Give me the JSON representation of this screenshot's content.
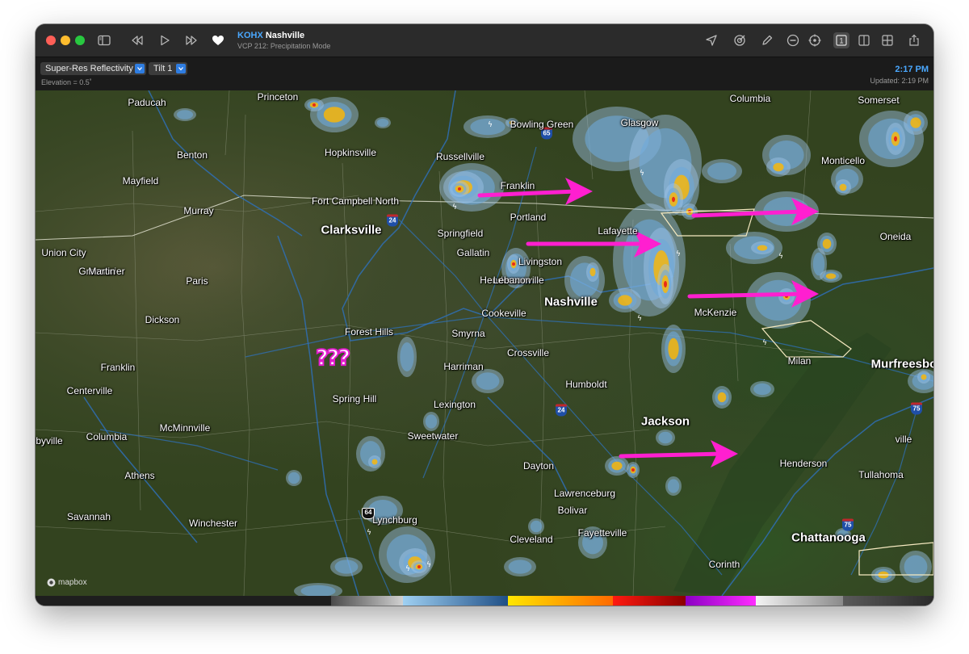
{
  "titlebar": {
    "station_call": "KOHX",
    "station_name": "Nashville",
    "subtitle": "VCP 212: Precipitation Mode",
    "traffic_lights": {
      "close": "#ff5f57",
      "minimize": "#febc2e",
      "zoom": "#28c840"
    },
    "toolbar_left_icons": [
      "sidebar-toggle-icon",
      "rewind-icon",
      "play-icon",
      "fast-forward-icon",
      "heart-icon"
    ],
    "toolbar_right_icons": [
      "location-arrow-icon",
      "target-icon",
      "pencil-icon",
      "minus-circle-icon",
      "crosshair-icon",
      "single-pane-icon",
      "split-pane-icon",
      "quad-pane-icon",
      "share-icon"
    ],
    "single_pane_label": "1"
  },
  "controls": {
    "product": "Super-Res Reflectivity",
    "tilt": "Tilt 1",
    "elevation": "Elevation = 0.5˚",
    "time": "2:17 PM",
    "updated": "Updated: 2:19 PM",
    "accent": "#4aa8ff"
  },
  "map": {
    "attribution": "mapbox",
    "annotation": "???",
    "annotation_color": "#e41ccf",
    "arrow_color": "#ff1fd0",
    "highway_shields": [
      "24",
      "65",
      "24",
      "75",
      "75",
      "64"
    ],
    "cities": [
      {
        "name": "Paducah",
        "big": false
      },
      {
        "name": "Princeton",
        "big": false
      },
      {
        "name": "Bowling Green",
        "big": false
      },
      {
        "name": "Glasgow",
        "big": false
      },
      {
        "name": "Columbia",
        "big": false
      },
      {
        "name": "Somerset",
        "big": false
      },
      {
        "name": "Hopkinsville",
        "big": false
      },
      {
        "name": "Russellville",
        "big": false
      },
      {
        "name": "Benton",
        "big": false
      },
      {
        "name": "Mayfield",
        "big": false
      },
      {
        "name": "Franklin",
        "big": false
      },
      {
        "name": "Monticello",
        "big": false
      },
      {
        "name": "Fort Campbell North",
        "big": false
      },
      {
        "name": "Murray",
        "big": false
      },
      {
        "name": "Portland",
        "big": false
      },
      {
        "name": "Clarksville",
        "big": true
      },
      {
        "name": "Springfield",
        "big": false
      },
      {
        "name": "Lafayette",
        "big": false
      },
      {
        "name": "Oneida",
        "big": false
      },
      {
        "name": "Union City",
        "big": false
      },
      {
        "name": "Greenbrier",
        "big": false
      },
      {
        "name": "Gallatin",
        "big": false
      },
      {
        "name": "Livingston",
        "big": false
      },
      {
        "name": "Martin",
        "big": false
      },
      {
        "name": "Paris",
        "big": false
      },
      {
        "name": "Hendersonville",
        "big": false
      },
      {
        "name": "Lebanon",
        "big": false
      },
      {
        "name": "Nashville",
        "big": true
      },
      {
        "name": "Cookeville",
        "big": false
      },
      {
        "name": "McKenzie",
        "big": false
      },
      {
        "name": "Dickson",
        "big": false
      },
      {
        "name": "Forest Hills",
        "big": false
      },
      {
        "name": "Smyrna",
        "big": false
      },
      {
        "name": "Crossville",
        "big": false
      },
      {
        "name": "Milan",
        "big": false
      },
      {
        "name": "Franklin",
        "big": false
      },
      {
        "name": "Harriman",
        "big": false
      },
      {
        "name": "Murfreesboro",
        "big": true
      },
      {
        "name": "Humboldt",
        "big": false
      },
      {
        "name": "Centerville",
        "big": false
      },
      {
        "name": "Spring Hill",
        "big": false
      },
      {
        "name": "Lexington",
        "big": false
      },
      {
        "name": "McMinnville",
        "big": false
      },
      {
        "name": "Jackson",
        "big": true
      },
      {
        "name": "Columbia",
        "big": false
      },
      {
        "name": "Sweetwater",
        "big": false
      },
      {
        "name": "ville",
        "big": false
      },
      {
        "name": "Shelbyville",
        "big": false
      },
      {
        "name": "Dayton",
        "big": false
      },
      {
        "name": "Henderson",
        "big": false
      },
      {
        "name": "Athens",
        "big": false
      },
      {
        "name": "Tullahoma",
        "big": false
      },
      {
        "name": "Lawrenceburg",
        "big": false
      },
      {
        "name": "Lynchburg",
        "big": false
      },
      {
        "name": "Bolivar",
        "big": false
      },
      {
        "name": "Savannah",
        "big": false
      },
      {
        "name": "Winchester",
        "big": false
      },
      {
        "name": "Fayetteville",
        "big": false
      },
      {
        "name": "Cleveland",
        "big": false
      },
      {
        "name": "Chattanooga",
        "big": true
      },
      {
        "name": "Corinth",
        "big": false
      }
    ]
  },
  "color_scale": [
    "#1e1e1e",
    "#1e1e1e",
    "#2a2a2a",
    "#6d6d6d",
    "#b4b4b4",
    "#8fc2e8",
    "#5b9acb",
    "#2d5f94",
    "#ffe600",
    "#ffb400",
    "#ff7a00",
    "#e21414",
    "#a00000",
    "#b000e0",
    "#ff20ff",
    "#f2f2f2",
    "#9a9a9a",
    "#4a4a4a"
  ]
}
